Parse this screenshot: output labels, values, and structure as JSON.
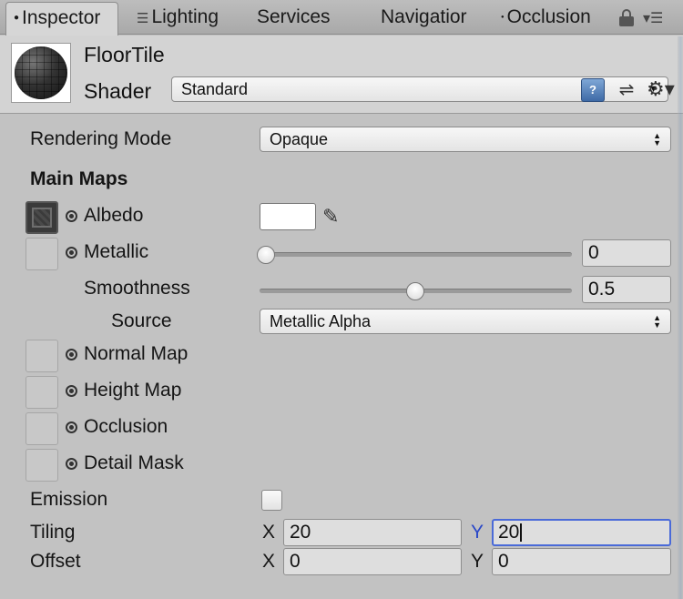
{
  "tabs": [
    {
      "label": "Inspector",
      "active": true,
      "icon": "info-dot"
    },
    {
      "label": "Lighting",
      "icon": "lighting-icon"
    },
    {
      "label": "Services"
    },
    {
      "label": "Navigatior"
    },
    {
      "label": "Occlusion",
      "icon": "occlusion-dot"
    }
  ],
  "header": {
    "material_name": "FloorTile",
    "shader_label": "Shader",
    "shader_value": "Standard"
  },
  "fields": {
    "rendering_mode_label": "Rendering Mode",
    "rendering_mode_value": "Opaque",
    "main_maps_heading": "Main Maps",
    "albedo_label": "Albedo",
    "albedo_color": "#ffffff",
    "metallic_label": "Metallic",
    "metallic_value": "0",
    "smoothness_label": "Smoothness",
    "smoothness_value": "0.5",
    "source_label": "Source",
    "source_value": "Metallic Alpha",
    "normal_map_label": "Normal Map",
    "height_map_label": "Height Map",
    "occlusion_label": "Occlusion",
    "detail_mask_label": "Detail Mask",
    "emission_label": "Emission",
    "emission_checked": false,
    "tiling_label": "Tiling",
    "tiling_x_axis": "X",
    "tiling_x": "20",
    "tiling_y_axis": "Y",
    "tiling_y": "20",
    "offset_label": "Offset",
    "offset_x_axis": "X",
    "offset_x": "0",
    "offset_y_axis": "Y",
    "offset_y": "0"
  },
  "colors": {
    "panel_bg": "#c2c2c2",
    "focus_blue": "#4a6ad8",
    "axis_active_blue": "#2a48c8"
  }
}
